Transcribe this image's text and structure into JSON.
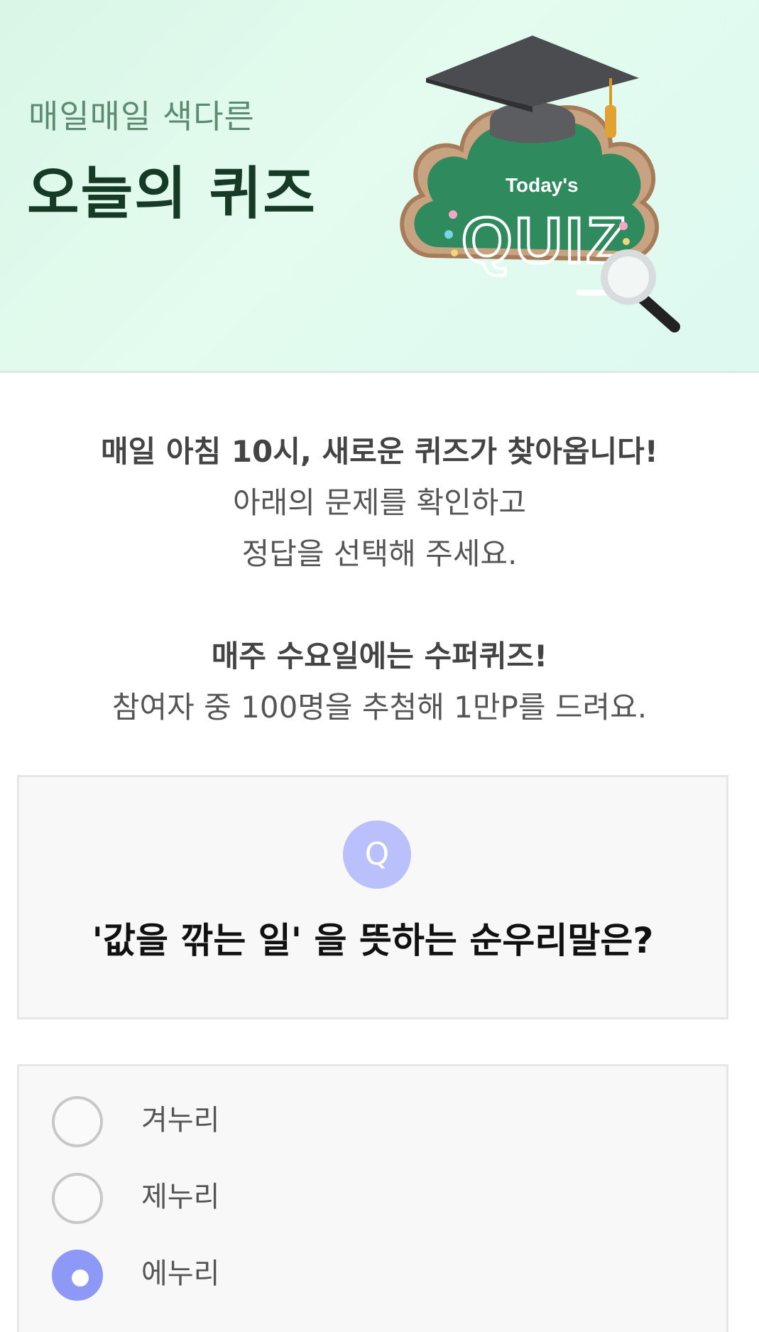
{
  "banner": {
    "subtitle": "매일매일 색다른",
    "title": "오늘의 퀴즈",
    "art": {
      "small_text": "Today's",
      "big_text": "QUIZ"
    }
  },
  "intro": {
    "line1": "매일 아침 10시, 새로운 퀴즈가 찾아옵니다!",
    "line2": "아래의 문제를 확인하고",
    "line3": "정답을 선택해 주세요.",
    "line4": "매주 수요일에는 수퍼퀴즈!",
    "line5": "참여자 중 100명을 추첨해 1만P를 드려요."
  },
  "question": {
    "badge": "Q",
    "text": "'값을 깎는 일' 을 뜻하는 순우리말은?"
  },
  "options": [
    {
      "label": "겨누리",
      "selected": false
    },
    {
      "label": "제누리",
      "selected": false
    },
    {
      "label": "에누리",
      "selected": true
    }
  ],
  "colors": {
    "accent": "#8e98f7",
    "badge": "#b9c0fb",
    "banner_bg": "#dcf8ea",
    "title_dark": "#163a26"
  }
}
